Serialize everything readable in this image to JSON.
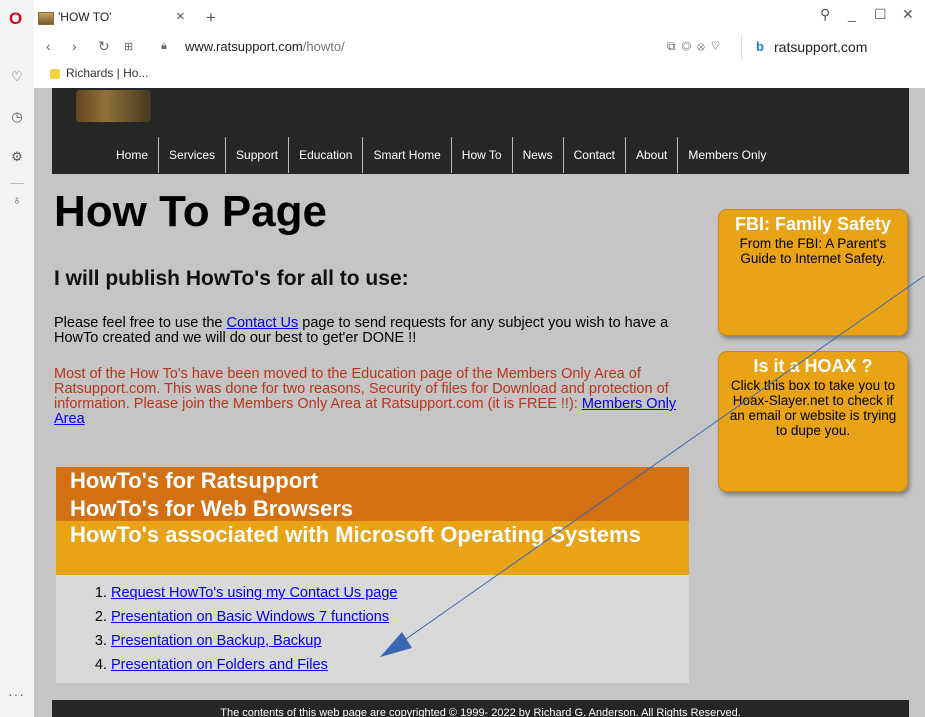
{
  "browser": {
    "tab_title": "'HOW TO'",
    "url_host": "www.ratsupport.com",
    "url_path": "/howto/",
    "side_panel_site": "ratsupport.com",
    "bookmark": "Richards | Ho..."
  },
  "page": {
    "nav": [
      "Home",
      "Services",
      "Support",
      "Education",
      "Smart Home",
      "How To",
      "News",
      "Contact",
      "About",
      "Members Only"
    ],
    "title": "How To Page",
    "subtitle": "I will publish HowTo's for all to use:",
    "para1_pre": "Please feel free to use the ",
    "para1_link": "Contact Us",
    "para1_post": " page to send requests for any subject you wish to have a HowTo created and we will do our best to get'er DONE !!",
    "para2_text": "Most of the How To's have been moved to the Education page of the Members Only Area of Ratsupport.com. This was done for two reasons, Security of files for Download and protection of information. Please join the Members Only Area at Ratsupport.com (it is FREE !!): ",
    "para2_link": "Members Only Area",
    "section1": "HowTo's for Ratsupport",
    "section2": "HowTo's for Web Browsers",
    "section3": "HowTo's associated with Microsoft Operating Systems",
    "list": [
      "Request HowTo's using my Contact Us page",
      "Presentation on Basic Windows 7 functions",
      "Presentation on Backup, Backup",
      "Presentation on Folders and Files"
    ],
    "card1_head": "FBI: Family Safety",
    "card1_body": "From the FBI: A Parent's Guide to Internet Safety.",
    "card2_head": "Is it a HOAX ?",
    "card2_body": "Click this box to take you to Hoax-Slayer.net to check if an email or website is trying to dupe you.",
    "footer": "The contents of this web page are copyrighted © 1999- 2022 by Richard G. Anderson. All Rights Reserved."
  },
  "colors": {
    "banner": "#262626",
    "page_bg": "#c5c5c5",
    "orange_dark": "#d37012",
    "orange_light": "#e8a317",
    "red_text": "#b8341c",
    "link": "#0000ee",
    "arrow": "#3a66b8"
  }
}
